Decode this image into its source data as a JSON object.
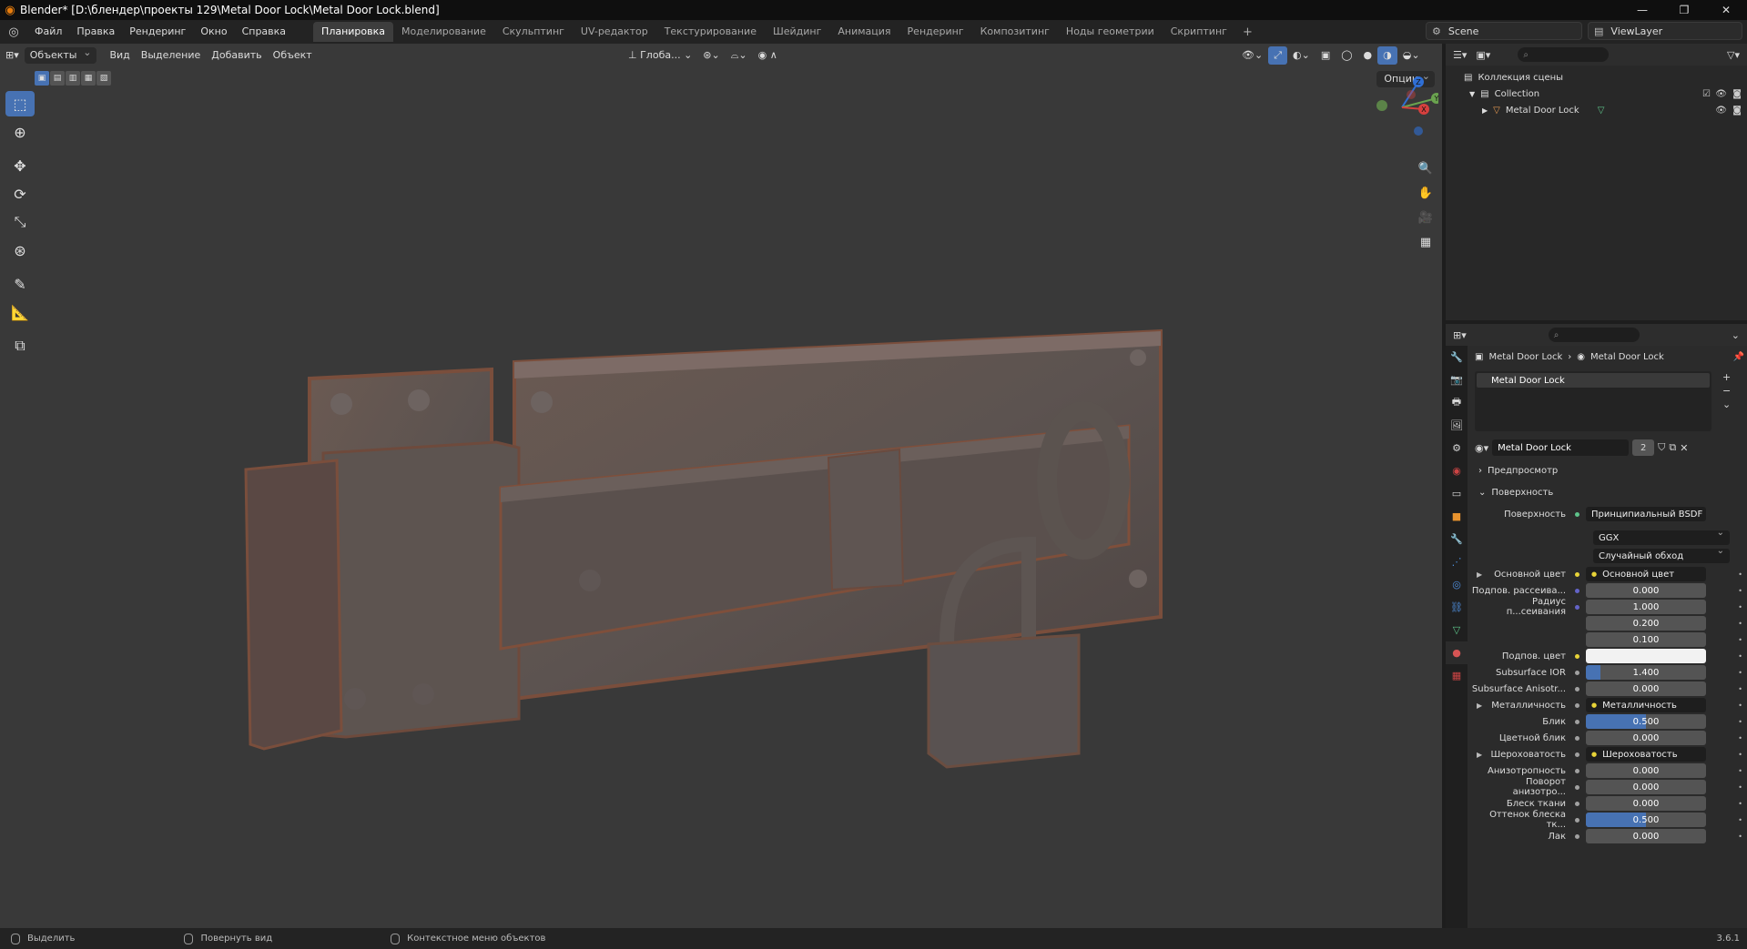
{
  "window": {
    "title": "Blender* [D:\\блендер\\проекты 129\\Metal Door Lock\\Metal Door Lock.blend]",
    "controls": [
      "—",
      "❐",
      "✕"
    ]
  },
  "menu": [
    "Файл",
    "Правка",
    "Рендеринг",
    "Окно",
    "Справка"
  ],
  "workspaces": [
    "Планировка",
    "Моделирование",
    "Скульптинг",
    "UV-редактор",
    "Текстурирование",
    "Шейдинг",
    "Анимация",
    "Рендеринг",
    "Композитинг",
    "Ноды геометрии",
    "Скриптинг"
  ],
  "active_workspace": "Планировка",
  "scene": {
    "scene_name": "Scene",
    "view_layer": "ViewLayer"
  },
  "viewport": {
    "mode": "Объекты",
    "menus": [
      "Вид",
      "Выделение",
      "Добавить",
      "Объект"
    ],
    "orientation": "Глоба...",
    "options": "Опции"
  },
  "outliner": {
    "root": "Коллекция сцены",
    "collection": "Collection",
    "object": "Metal Door Lock"
  },
  "properties": {
    "breadcrumb_object": "Metal Door Lock",
    "breadcrumb_material": "Metal Door Lock",
    "slot_name": "Metal Door Lock",
    "material_name": "Metal Door Lock",
    "users": "2",
    "preview_label": "Предпросмотр",
    "surface_label": "Поверхность",
    "surface_row_label": "Поверхность",
    "surface_shader": "Принципиальный BSDF",
    "distribution": "GGX",
    "subsurface_method": "Случайный обход",
    "rows": [
      {
        "label": "Основной цвет",
        "type": "link",
        "value": "Основной цвет",
        "dot": "#e8d438",
        "expand": true
      },
      {
        "label": "Подпов. рассеива...",
        "type": "num",
        "value": "0.000",
        "dot": "#6363c7",
        "fill": 0
      },
      {
        "label": "Радиус п...сеивания",
        "type": "num",
        "value": "1.000",
        "dot": "#6363c7",
        "fill": 0
      },
      {
        "label": "",
        "type": "num",
        "value": "0.200",
        "dot": "",
        "fill": 0
      },
      {
        "label": "",
        "type": "num",
        "value": "0.100",
        "dot": "",
        "fill": 0
      },
      {
        "label": "Подпов. цвет",
        "type": "color",
        "value": "",
        "dot": "#e8d438"
      },
      {
        "label": "Subsurface IOR",
        "type": "num",
        "value": "1.400",
        "dot": "#a1a1a1",
        "fill": 0.12
      },
      {
        "label": "Subsurface Anisotr...",
        "type": "num",
        "value": "0.000",
        "dot": "#a1a1a1",
        "fill": 0
      },
      {
        "label": "Металличность",
        "type": "link",
        "value": "Металличность",
        "dot": "#a1a1a1",
        "expand": true
      },
      {
        "label": "Блик",
        "type": "num",
        "value": "0.500",
        "dot": "#a1a1a1",
        "fill": 0.5
      },
      {
        "label": "Цветной блик",
        "type": "num",
        "value": "0.000",
        "dot": "#a1a1a1",
        "fill": 0
      },
      {
        "label": "Шероховатость",
        "type": "link",
        "value": "Шероховатость",
        "dot": "#a1a1a1",
        "expand": true
      },
      {
        "label": "Анизотропность",
        "type": "num",
        "value": "0.000",
        "dot": "#a1a1a1",
        "fill": 0
      },
      {
        "label": "Поворот анизотро...",
        "type": "num",
        "value": "0.000",
        "dot": "#a1a1a1",
        "fill": 0
      },
      {
        "label": "Блеск ткани",
        "type": "num",
        "value": "0.000",
        "dot": "#a1a1a1",
        "fill": 0
      },
      {
        "label": "Оттенок блеска тк...",
        "type": "num",
        "value": "0.500",
        "dot": "#a1a1a1",
        "fill": 0.5
      },
      {
        "label": "Лак",
        "type": "num",
        "value": "0.000",
        "dot": "#a1a1a1",
        "fill": 0
      }
    ]
  },
  "status": {
    "select": "Выделить",
    "rotate": "Повернуть вид",
    "context": "Контекстное меню объектов",
    "version": "3.6.1"
  },
  "colors": {
    "accent": "#4772b3",
    "brand": "#e87d0d"
  }
}
